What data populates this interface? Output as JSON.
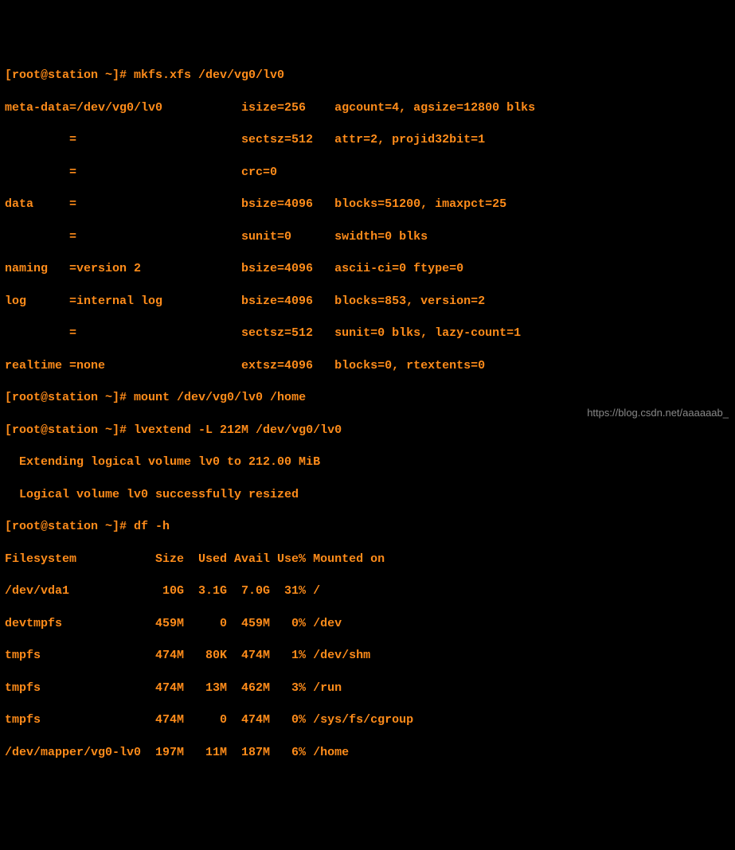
{
  "prompt1": "[root@station ~]# ",
  "cmd1": "mkfs.xfs /dev/vg0/lv0",
  "mkfs": {
    "l1": "meta-data=/dev/vg0/lv0           isize=256    agcount=4, agsize=12800 blks",
    "l2": "         =                       sectsz=512   attr=2, projid32bit=1",
    "l3": "         =                       crc=0",
    "l4": "data     =                       bsize=4096   blocks=51200, imaxpct=25",
    "l5": "         =                       sunit=0      swidth=0 blks",
    "l6": "naming   =version 2              bsize=4096   ascii-ci=0 ftype=0",
    "l7": "log      =internal log           bsize=4096   blocks=853, version=2",
    "l8": "         =                       sectsz=512   sunit=0 blks, lazy-count=1",
    "l9": "realtime =none                   extsz=4096   blocks=0, rtextents=0"
  },
  "prompt2": "[root@station ~]# ",
  "cmd2": "mount /dev/vg0/lv0 /home",
  "prompt3": "[root@station ~]# ",
  "cmd3": "lvextend -L 212M /dev/vg0/lv0",
  "lvextend": {
    "l1": "  Extending logical volume lv0 to 212.00 MiB",
    "l2": "  Logical volume lv0 successfully resized"
  },
  "prompt4": "[root@station ~]# ",
  "cmd4": "df -h",
  "df": {
    "header": "Filesystem           Size  Used Avail Use% Mounted on",
    "rows": [
      "/dev/vda1             10G  3.1G  7.0G  31% /",
      "devtmpfs             459M     0  459M   0% /dev",
      "tmpfs                474M   80K  474M   1% /dev/shm",
      "tmpfs                474M   13M  462M   3% /run",
      "tmpfs                474M     0  474M   0% /sys/fs/cgroup",
      "/dev/mapper/vg0-lv0  197M   11M  187M   6% /home"
    ]
  },
  "watermark": "https://blog.csdn.net/aaaaaab_"
}
